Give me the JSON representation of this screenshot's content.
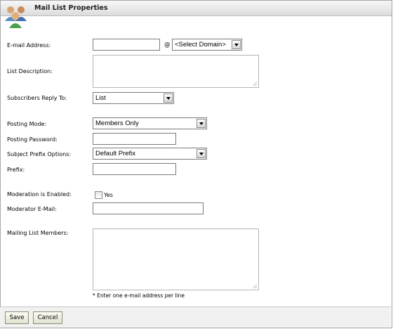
{
  "window": {
    "title": "Mail List Properties",
    "icon": "users-group-icon"
  },
  "form": {
    "email_label": "E-mail Address:",
    "email_value": "",
    "at_sign": "@",
    "domain_select": "<Select Domain>",
    "description_label": "List Description:",
    "description_value": "",
    "reply_label": "Subscribers Reply To:",
    "reply_select": "List",
    "posting_mode_label": "Posting Mode:",
    "posting_mode_select": "Members Only",
    "posting_password_label": "Posting Password:",
    "posting_password_value": "",
    "subject_prefix_label": "Subject Prefix Options:",
    "subject_prefix_select": "Default Prefix",
    "prefix_label": "Prefix:",
    "prefix_value": "",
    "moderation_label": "Moderation is Enabled:",
    "moderation_checked": false,
    "moderation_option": "Yes",
    "moderator_email_label": "Moderator E-Mail:",
    "moderator_email_value": "",
    "members_label": "Mailing List Members:",
    "members_value": "",
    "members_hint": "* Enter one e-mail address per line"
  },
  "buttons": {
    "save": "Save",
    "cancel": "Cancel"
  }
}
